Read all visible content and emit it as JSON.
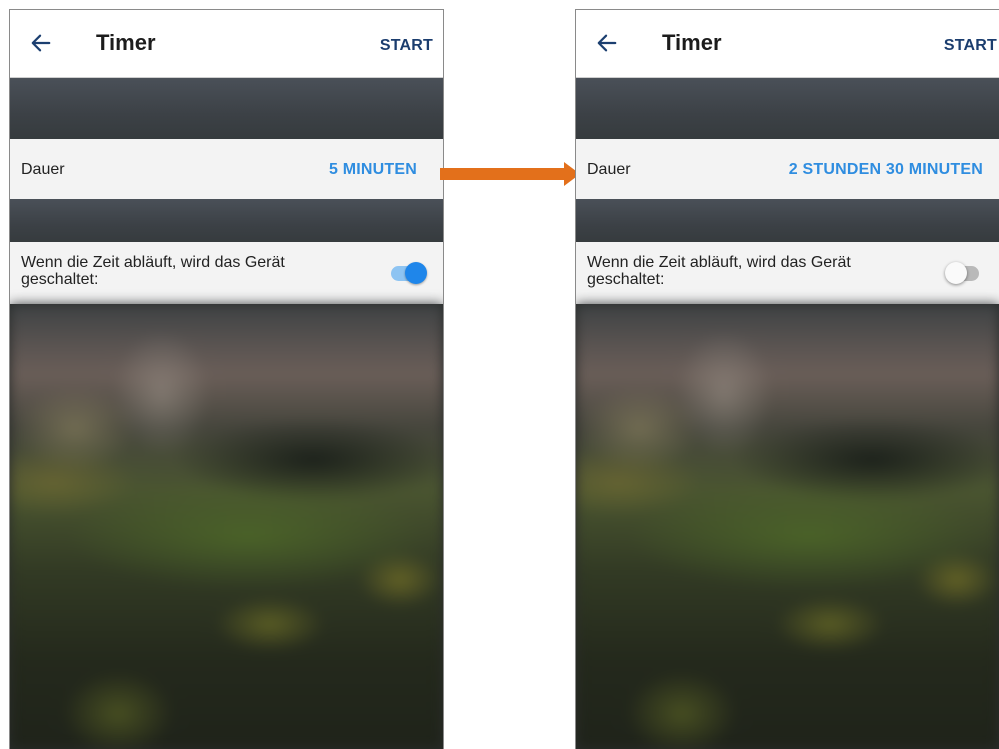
{
  "colors": {
    "accent": "#2F8DE0",
    "start_text": "#1B3D6E",
    "toggle_on": "#1F86EA",
    "arrow": "#E3701B"
  },
  "icons": {
    "back": "arrow-left-icon",
    "transition": "right-arrow-icon"
  },
  "screens": [
    {
      "appbar": {
        "title": "Timer",
        "start_label": "START"
      },
      "duration": {
        "label": "Dauer",
        "value": "5 MINUTEN"
      },
      "switch_row": {
        "label": "Wenn die Zeit abläuft, wird das Gerät geschaltet:",
        "on": true
      }
    },
    {
      "appbar": {
        "title": "Timer",
        "start_label": "START"
      },
      "duration": {
        "label": "Dauer",
        "value": "2 STUNDEN 30 MINUTEN"
      },
      "switch_row": {
        "label": "Wenn die Zeit abläuft, wird das Gerät geschaltet:",
        "on": false
      }
    }
  ]
}
